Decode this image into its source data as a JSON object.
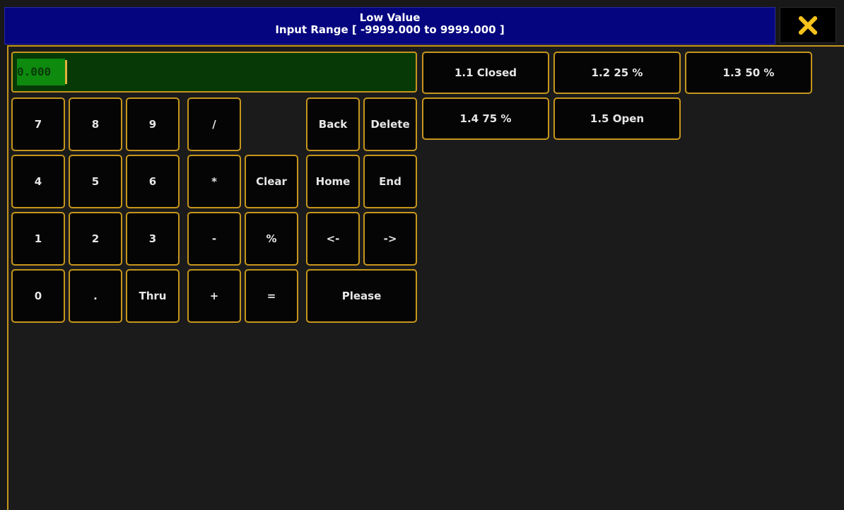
{
  "titlebar": {
    "title": "Low Value",
    "subtitle": "Input Range [ -9999.000 to 9999.000 ]"
  },
  "close": {
    "icon": "close-x-icon",
    "color": "#f7c31a"
  },
  "input": {
    "value": "0.000",
    "selected": true
  },
  "keys": {
    "k7": "7",
    "k8": "8",
    "k9": "9",
    "slash": "/",
    "back": "Back",
    "delete": "Delete",
    "k4": "4",
    "k5": "5",
    "k6": "6",
    "star": "*",
    "clear": "Clear",
    "home": "Home",
    "end": "End",
    "k1": "1",
    "k2": "2",
    "k3": "3",
    "minus": "-",
    "percent": "%",
    "left": "<-",
    "right": "->",
    "k0": "0",
    "dot": ".",
    "thru": "Thru",
    "plus": "+",
    "equals": "=",
    "please": "Please"
  },
  "presets": [
    {
      "label": "1.1 Closed"
    },
    {
      "label": "1.2 25 %"
    },
    {
      "label": "1.3 50 %"
    },
    {
      "label": "1.4 75 %"
    },
    {
      "label": "1.5 Open"
    }
  ],
  "colors": {
    "accent_border": "#c6961c",
    "title_bg": "#050580",
    "input_bg": "#073907",
    "input_selection": "#0e8a0e",
    "key_bg": "#050505",
    "window_bg": "#181818"
  }
}
